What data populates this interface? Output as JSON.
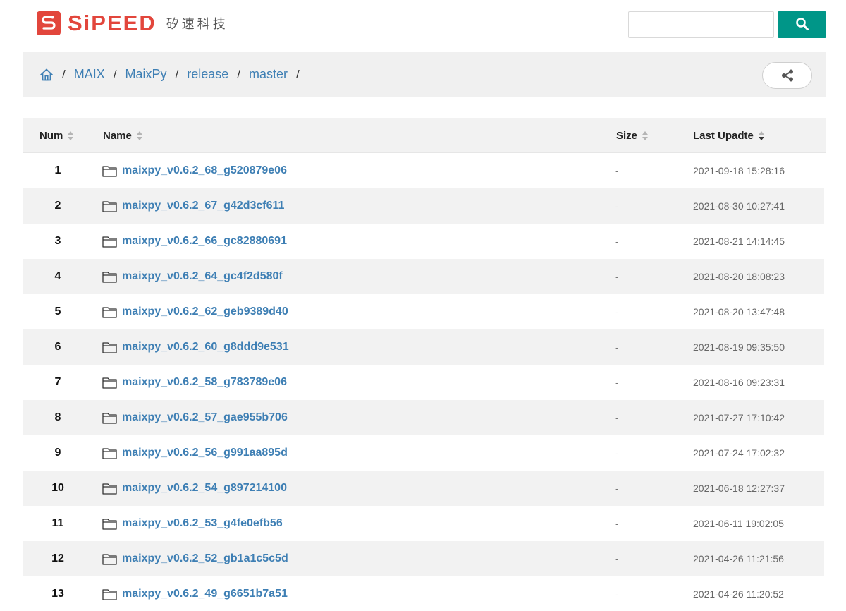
{
  "header": {
    "brand": "SiPEED",
    "brand_cn": "矽速科技",
    "search": {
      "placeholder": "",
      "value": ""
    }
  },
  "breadcrumb": {
    "items": [
      {
        "label": "MAIX"
      },
      {
        "label": "MaixPy"
      },
      {
        "label": "release"
      },
      {
        "label": "master"
      }
    ],
    "separator": "/"
  },
  "table": {
    "columns": {
      "num": "Num",
      "name": "Name",
      "size": "Size",
      "last_update": "Last Upadte"
    },
    "sorted_column": "last_update",
    "sort_direction": "desc",
    "rows": [
      {
        "num": "1",
        "name": "maixpy_v0.6.2_68_g520879e06",
        "size": "-",
        "date": "2021-09-18 15:28:16"
      },
      {
        "num": "2",
        "name": "maixpy_v0.6.2_67_g42d3cf611",
        "size": "-",
        "date": "2021-08-30 10:27:41"
      },
      {
        "num": "3",
        "name": "maixpy_v0.6.2_66_gc82880691",
        "size": "-",
        "date": "2021-08-21 14:14:45"
      },
      {
        "num": "4",
        "name": "maixpy_v0.6.2_64_gc4f2d580f",
        "size": "-",
        "date": "2021-08-20 18:08:23"
      },
      {
        "num": "5",
        "name": "maixpy_v0.6.2_62_geb9389d40",
        "size": "-",
        "date": "2021-08-20 13:47:48"
      },
      {
        "num": "6",
        "name": "maixpy_v0.6.2_60_g8ddd9e531",
        "size": "-",
        "date": "2021-08-19 09:35:50"
      },
      {
        "num": "7",
        "name": "maixpy_v0.6.2_58_g783789e06",
        "size": "-",
        "date": "2021-08-16 09:23:31"
      },
      {
        "num": "8",
        "name": "maixpy_v0.6.2_57_gae955b706",
        "size": "-",
        "date": "2021-07-27 17:10:42"
      },
      {
        "num": "9",
        "name": "maixpy_v0.6.2_56_g991aa895d",
        "size": "-",
        "date": "2021-07-24 17:02:32"
      },
      {
        "num": "10",
        "name": "maixpy_v0.6.2_54_g897214100",
        "size": "-",
        "date": "2021-06-18 12:27:37"
      },
      {
        "num": "11",
        "name": "maixpy_v0.6.2_53_g4fe0efb56",
        "size": "-",
        "date": "2021-06-11 19:02:05"
      },
      {
        "num": "12",
        "name": "maixpy_v0.6.2_52_gb1a1c5c5d",
        "size": "-",
        "date": "2021-04-26 11:21:56"
      },
      {
        "num": "13",
        "name": "maixpy_v0.6.2_49_g6651b7a51",
        "size": "-",
        "date": "2021-04-26 11:20:52"
      }
    ]
  },
  "icons": {
    "logo": "sipeed-logo-icon",
    "search": "search-icon",
    "home": "home-icon",
    "share": "share-icon",
    "folder": "folder-icon"
  },
  "colors": {
    "brand_red": "#e2463c",
    "link_blue": "#3e7fb4",
    "search_button_teal": "#009688",
    "stripe_gray": "#f2f2f2"
  }
}
